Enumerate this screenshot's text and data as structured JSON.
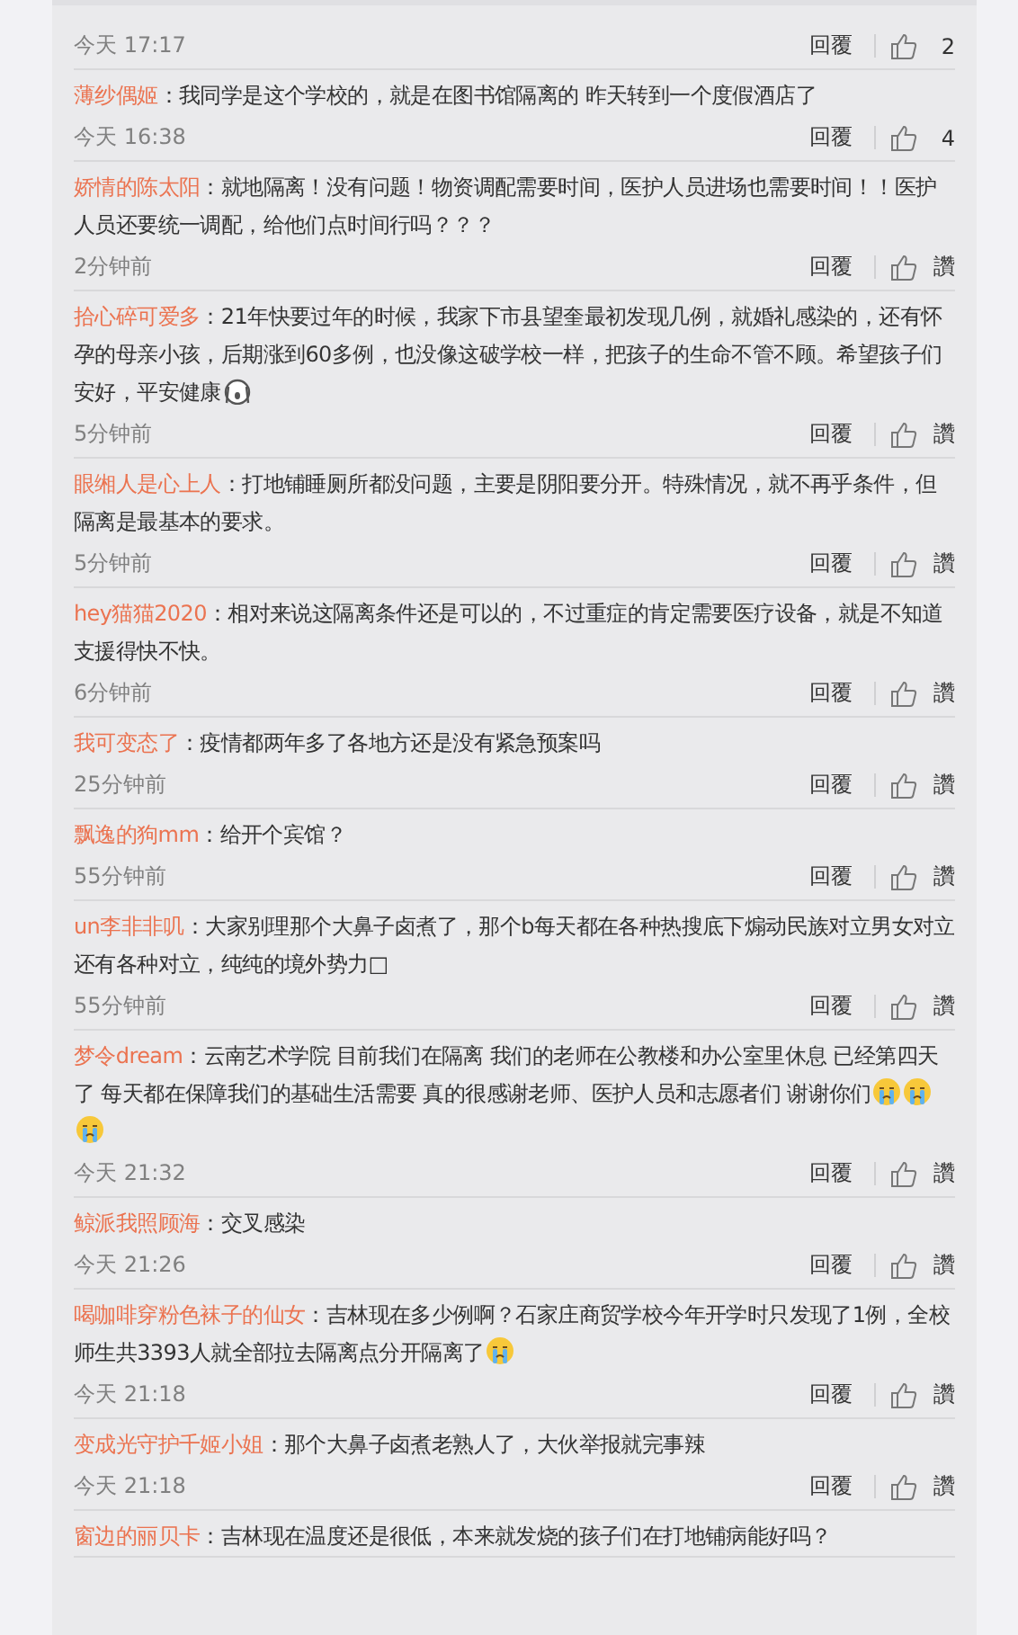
{
  "comments": [
    {
      "time": "今天 17:17",
      "reply": "回覆",
      "like": "2"
    },
    {
      "user": "薄纱偶姬",
      "text": "：我同学是这个学校的，就是在图书馆隔离的 昨天转到一个度假酒店了",
      "time": "今天 16:38",
      "reply": "回覆",
      "like": "4"
    },
    {
      "user": "娇情的陈太阳",
      "text": "：就地隔离！没有问题！物资调配需要时间，医护人员进场也需要时间！！医护人员还要统一调配，给他们点时间行吗？？？",
      "time": "2分钟前",
      "reply": "回覆",
      "like": "讚"
    },
    {
      "user": "拾心碎可爱多",
      "text": "：21年快要过年的时候，我家下市县望奎最初发现几例，就婚礼感染的，还有怀孕的母亲小孩，后期涨到60多例，也没像这破学校一样，把孩子的生命不管不顾。希望孩子们安好，平安健康",
      "emoji": [
        {
          "kind": "scream"
        }
      ],
      "time": "5分钟前",
      "reply": "回覆",
      "like": "讚"
    },
    {
      "user": "眼缃人是心上人",
      "text": "：打地铺睡厕所都没问题，主要是阴阳要分开。特殊情况，就不再乎条件，但隔离是最基本的要求。",
      "time": "5分钟前",
      "reply": "回覆",
      "like": "讚"
    },
    {
      "user": "hey猫猫2020",
      "text": "：相对来说这隔离条件还是可以的，不过重症的肯定需要医疗设备，就是不知道支援得快不快。",
      "time": "6分钟前",
      "reply": "回覆",
      "like": "讚"
    },
    {
      "user": "我可变态了",
      "text": "：疫情都两年多了各地方还是没有紧急预案吗",
      "time": "25分钟前",
      "reply": "回覆",
      "like": "讚"
    },
    {
      "user": "飘逸的狗mm",
      "text": "：给开个宾馆？",
      "time": "55分钟前",
      "reply": "回覆",
      "like": "讚"
    },
    {
      "user": "un李非非叽",
      "text": "：大家别理那个大鼻子卤煮了，那个b每天都在各种热搜底下煽动民族对立男女对立还有各种对立，纯纯的境外势力□",
      "time": "55分钟前",
      "reply": "回覆",
      "like": "讚"
    },
    {
      "user": "梦令dream",
      "text": "：云南艺术学院 目前我们在隔离 我们的老师在公教楼和办公室里休息 已经第四天了 每天都在保障我们的基础生活需要 真的很感谢老师、医护人员和志愿者们 谢谢你们",
      "emoji": [
        {
          "kind": "cry"
        },
        {
          "kind": "cry"
        },
        {
          "kind": "cry"
        }
      ],
      "time": "今天 21:32",
      "reply": "回覆",
      "like": "讚"
    },
    {
      "user": "鲸派我照顾海",
      "text": "：交叉感染",
      "time": "今天 21:26",
      "reply": "回覆",
      "like": "讚"
    },
    {
      "user": "喝咖啡穿粉色袜子的仙女",
      "text": "：吉林现在多少例啊？石家庄商贸学校今年开学时只发现了1例，全校师生共3393人就全部拉去隔离点分开隔离了",
      "emoji": [
        {
          "kind": "cry"
        }
      ],
      "time": "今天 21:18",
      "reply": "回覆",
      "like": "讚"
    },
    {
      "user": "变成光守护千姬小姐",
      "text": "：那个大鼻子卤煮老熟人了，大伙举报就完事辣",
      "time": "今天 21:18",
      "reply": "回覆",
      "like": "讚"
    },
    {
      "user": "窗边的丽贝卡",
      "text": "：吉林现在温度还是很低，本来就发烧的孩子们在打地铺病能好吗？"
    }
  ]
}
